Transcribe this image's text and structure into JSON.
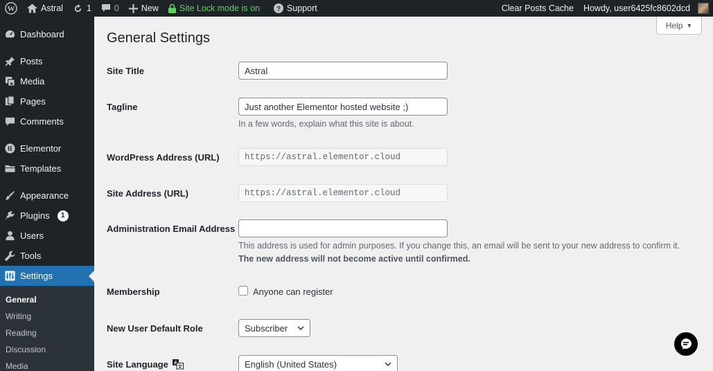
{
  "adminbar": {
    "site_name": "Astral",
    "updates_count": "1",
    "comments_count": "0",
    "new_label": "New",
    "sitelock_label": "Site Lock mode is on",
    "support_label": "Support",
    "clear_cache_label": "Clear Posts Cache",
    "howdy_label": "Howdy, user6425fc8602dcd"
  },
  "sidebar": {
    "items": [
      {
        "label": "Dashboard",
        "icon": "dashboard-icon"
      },
      {
        "label": "Posts",
        "icon": "pin-icon"
      },
      {
        "label": "Media",
        "icon": "media-icon"
      },
      {
        "label": "Pages",
        "icon": "pages-icon"
      },
      {
        "label": "Comments",
        "icon": "comment-icon"
      },
      {
        "label": "Elementor",
        "icon": "elementor-icon"
      },
      {
        "label": "Templates",
        "icon": "folder-icon"
      },
      {
        "label": "Appearance",
        "icon": "brush-icon"
      },
      {
        "label": "Plugins",
        "icon": "plugin-icon",
        "badge": "1"
      },
      {
        "label": "Users",
        "icon": "user-icon"
      },
      {
        "label": "Tools",
        "icon": "wrench-icon"
      },
      {
        "label": "Settings",
        "icon": "settings-icon"
      }
    ],
    "submenu": [
      "General",
      "Writing",
      "Reading",
      "Discussion",
      "Media"
    ]
  },
  "main": {
    "title": "General Settings",
    "help_label": "Help",
    "site_title_label": "Site Title",
    "site_title_value": "Astral",
    "tagline_label": "Tagline",
    "tagline_value": "Just another Elementor hosted website ;)",
    "tagline_desc": "In a few words, explain what this site is about.",
    "wp_address_label": "WordPress Address (URL)",
    "wp_address_value": "https://astral.elementor.cloud",
    "site_address_label": "Site Address (URL)",
    "site_address_value": "https://astral.elementor.cloud",
    "admin_email_label": "Administration Email Address",
    "admin_email_value": "",
    "admin_email_desc": "This address is used for admin purposes. If you change this, an email will be sent to your new address to confirm it.",
    "admin_email_desc_bold": "The new address will not become active until confirmed.",
    "membership_label": "Membership",
    "membership_checkbox_label": "Anyone can register",
    "default_role_label": "New User Default Role",
    "default_role_value": "Subscriber",
    "site_language_label": "Site Language",
    "site_language_value": "English (United States)"
  },
  "colors": {
    "adminbar_bg": "#1d2327",
    "accent": "#2271b1",
    "sitelock": "#5fd35f"
  }
}
